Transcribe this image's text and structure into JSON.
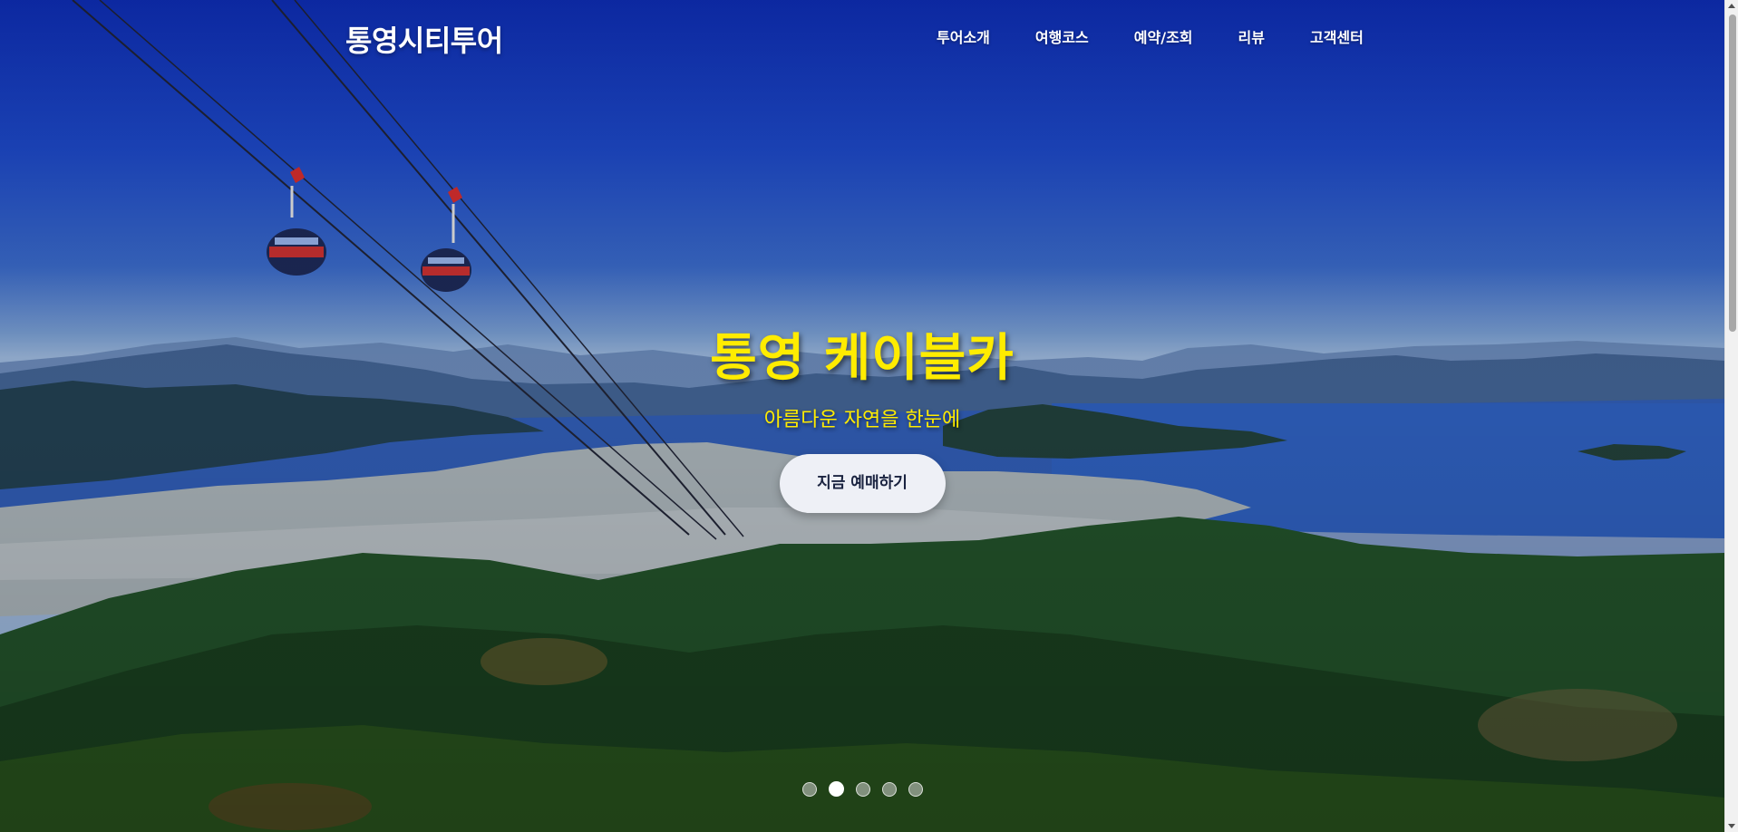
{
  "header": {
    "logo": "통영시티투어",
    "nav": [
      {
        "label": "투어소개"
      },
      {
        "label": "여행코스"
      },
      {
        "label": "예약/조회"
      },
      {
        "label": "리뷰"
      },
      {
        "label": "고객센터"
      }
    ]
  },
  "hero": {
    "title": "통영 케이블카",
    "subtitle": "아름다운 자연을 한눈에",
    "cta_label": "지금 예매하기"
  },
  "slider": {
    "total_slides": 5,
    "active_index": 1
  },
  "colors": {
    "title_accent": "#ffec00",
    "cta_background": "#eef0f6",
    "cta_text": "#1a2340"
  }
}
